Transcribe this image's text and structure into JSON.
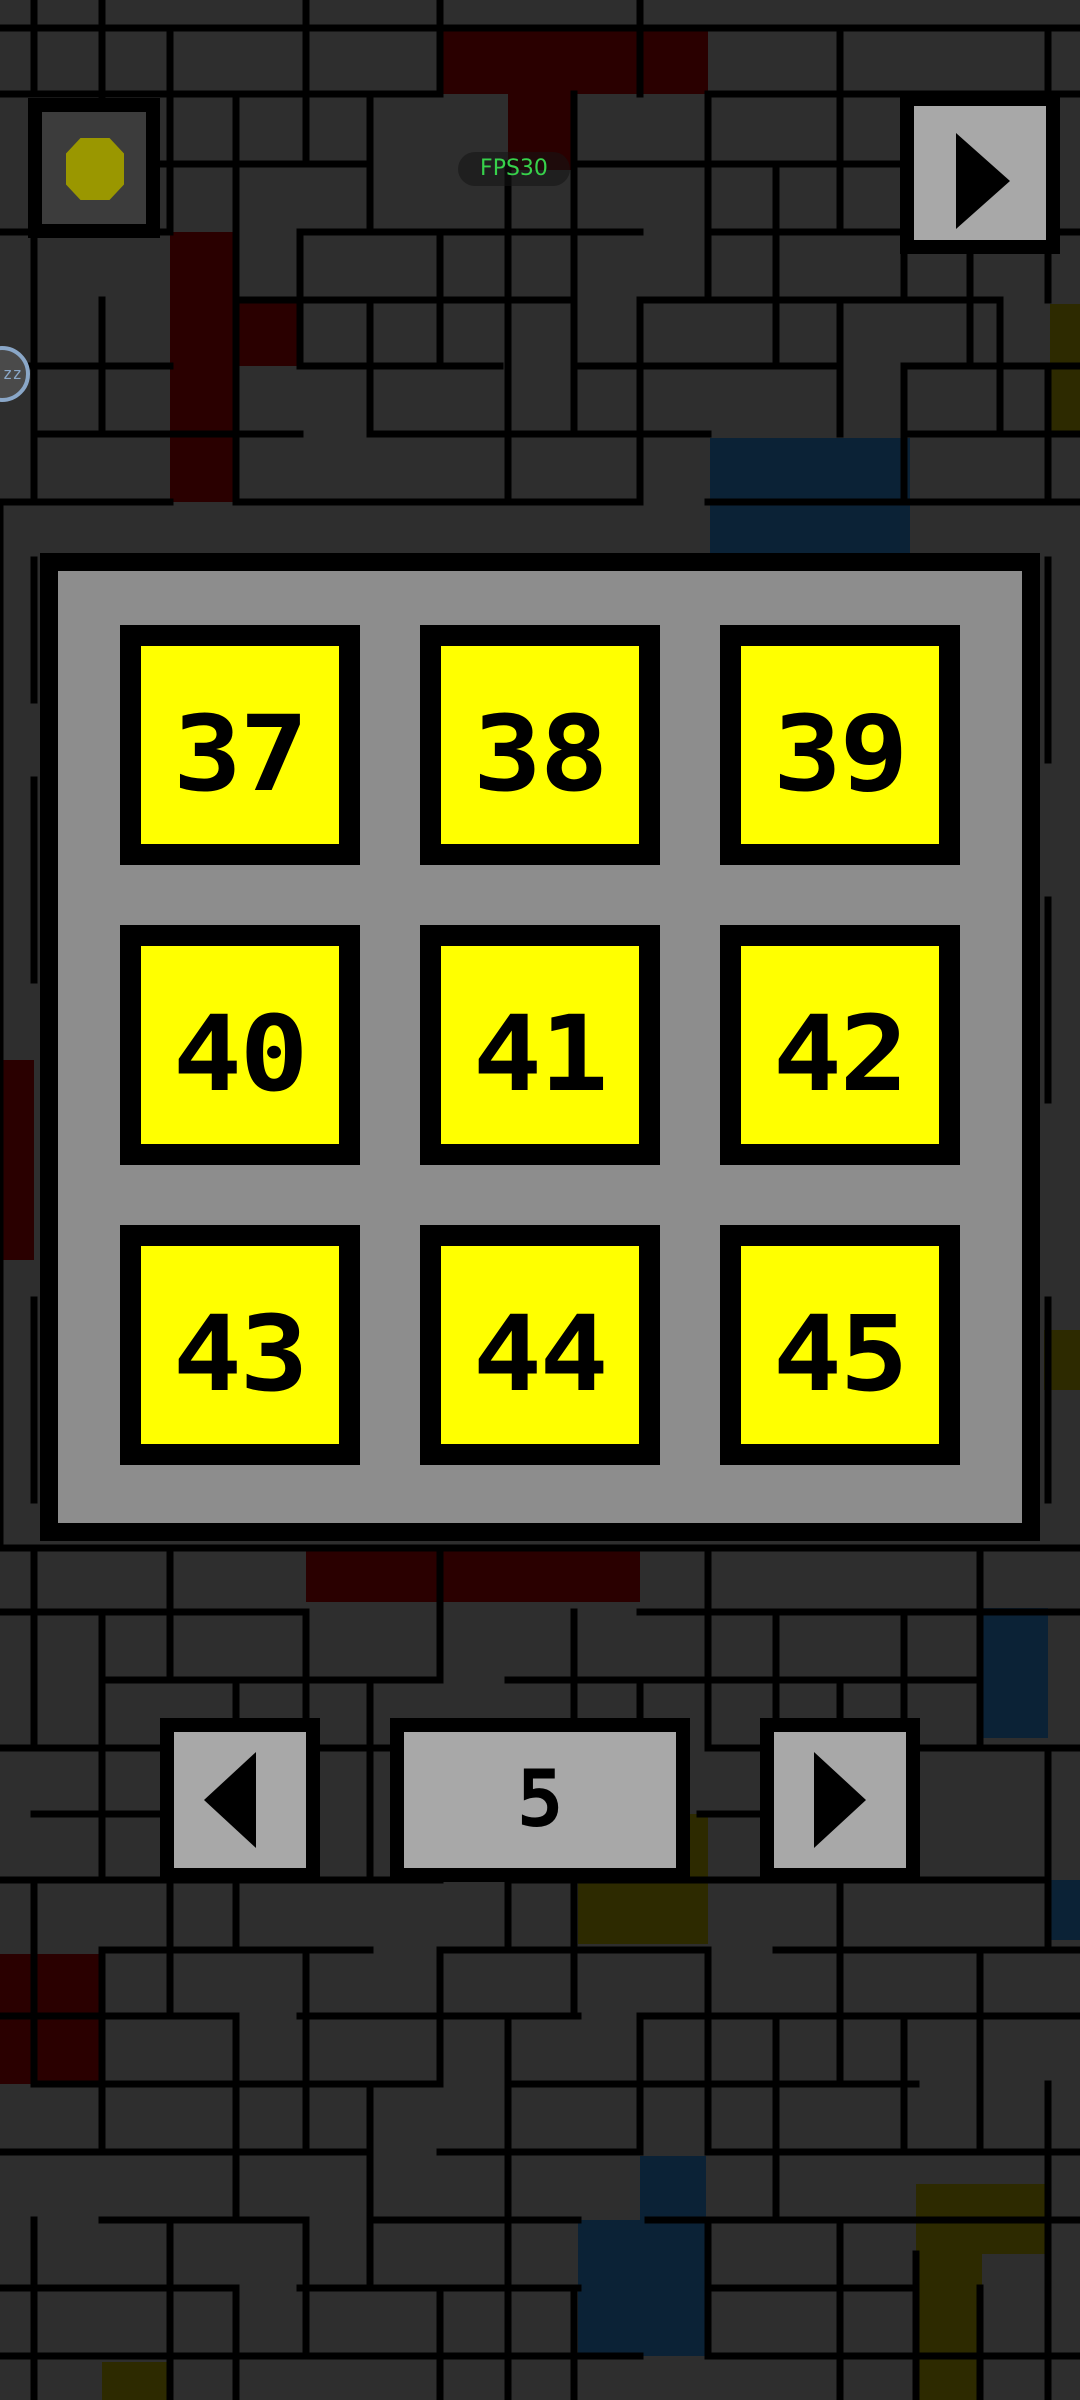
{
  "hud": {
    "fps_label": "FPS30",
    "side_badge_label": "zz"
  },
  "icons": {
    "coin": "coin-icon",
    "play": "play-icon",
    "prev": "arrow-left-icon",
    "next": "arrow-right-icon"
  },
  "level_select": {
    "levels": [
      "37",
      "38",
      "39",
      "40",
      "41",
      "42",
      "43",
      "44",
      "45"
    ]
  },
  "pager": {
    "page": "5"
  },
  "colors": {
    "background": "#2e2e2e",
    "maze_line": "#000000",
    "panel": "#8d8d8d",
    "level_face": "#ffff00",
    "button_face": "#a8a8a8",
    "coin": "#9a9700",
    "fps_text": "#37d24b",
    "tint_red": "#2a0000",
    "tint_blue": "#0b2236",
    "tint_yellow": "#2d2a00"
  }
}
